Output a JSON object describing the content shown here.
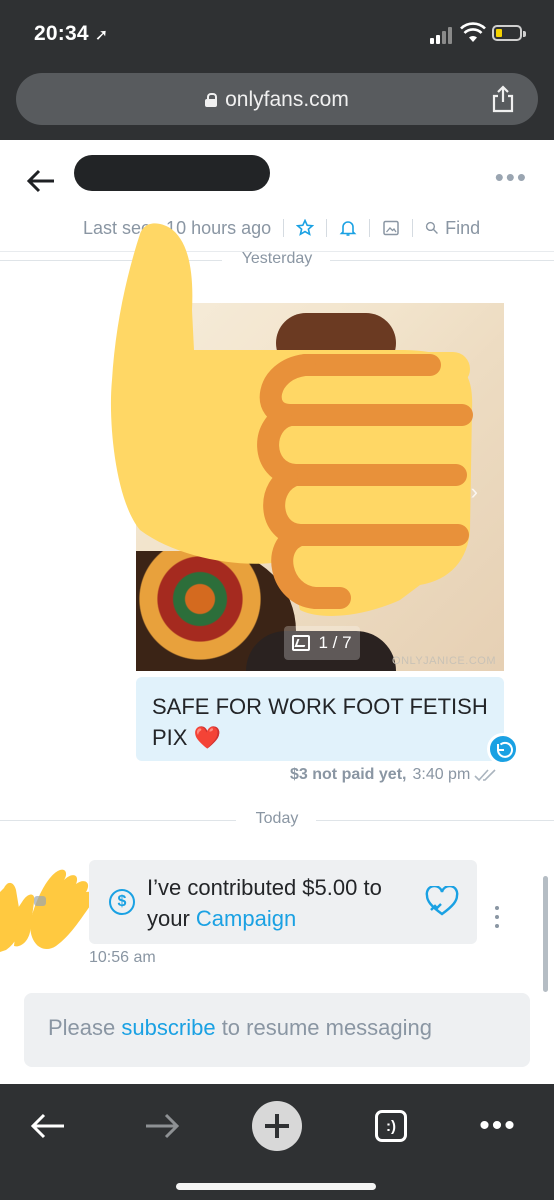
{
  "status_bar": {
    "time": "20:34"
  },
  "browser": {
    "url": "onlyfans.com"
  },
  "chat_header": {
    "last_seen": "Last seen 10 hours ago",
    "find_label": "Find"
  },
  "messages": {
    "yesterday_label": "Yesterday",
    "photo_counter": "1 / 7",
    "photo_watermark": "ONLYJANICE.COM",
    "outgoing_text": "SAFE FOR WORK FOOT FETISH PIX",
    "outgoing_price": "$3 not paid yet,",
    "outgoing_time": "3:40 pm",
    "today_label": "Today",
    "incoming_text_prefix": "I’ve contributed $5.00 to your",
    "incoming_link": "Campaign",
    "incoming_time": "10:56 am"
  },
  "composer": {
    "prefix": "Please",
    "link": "subscribe",
    "suffix": "to resume messaging"
  },
  "icons": {
    "back": "back-arrow-icon",
    "more": "more-horizontal-icon",
    "star": "star-icon",
    "bell": "bell-icon",
    "image": "image-icon",
    "search": "search-icon",
    "reply": "reply-icon",
    "dollar": "dollar-circle-icon",
    "heart": "heart-outline-icon"
  },
  "colors": {
    "accent": "#1aa1e3",
    "outgoing_bubble": "#e1f2fb",
    "incoming_bubble": "#eef0f2",
    "chrome": "#2f3133"
  }
}
